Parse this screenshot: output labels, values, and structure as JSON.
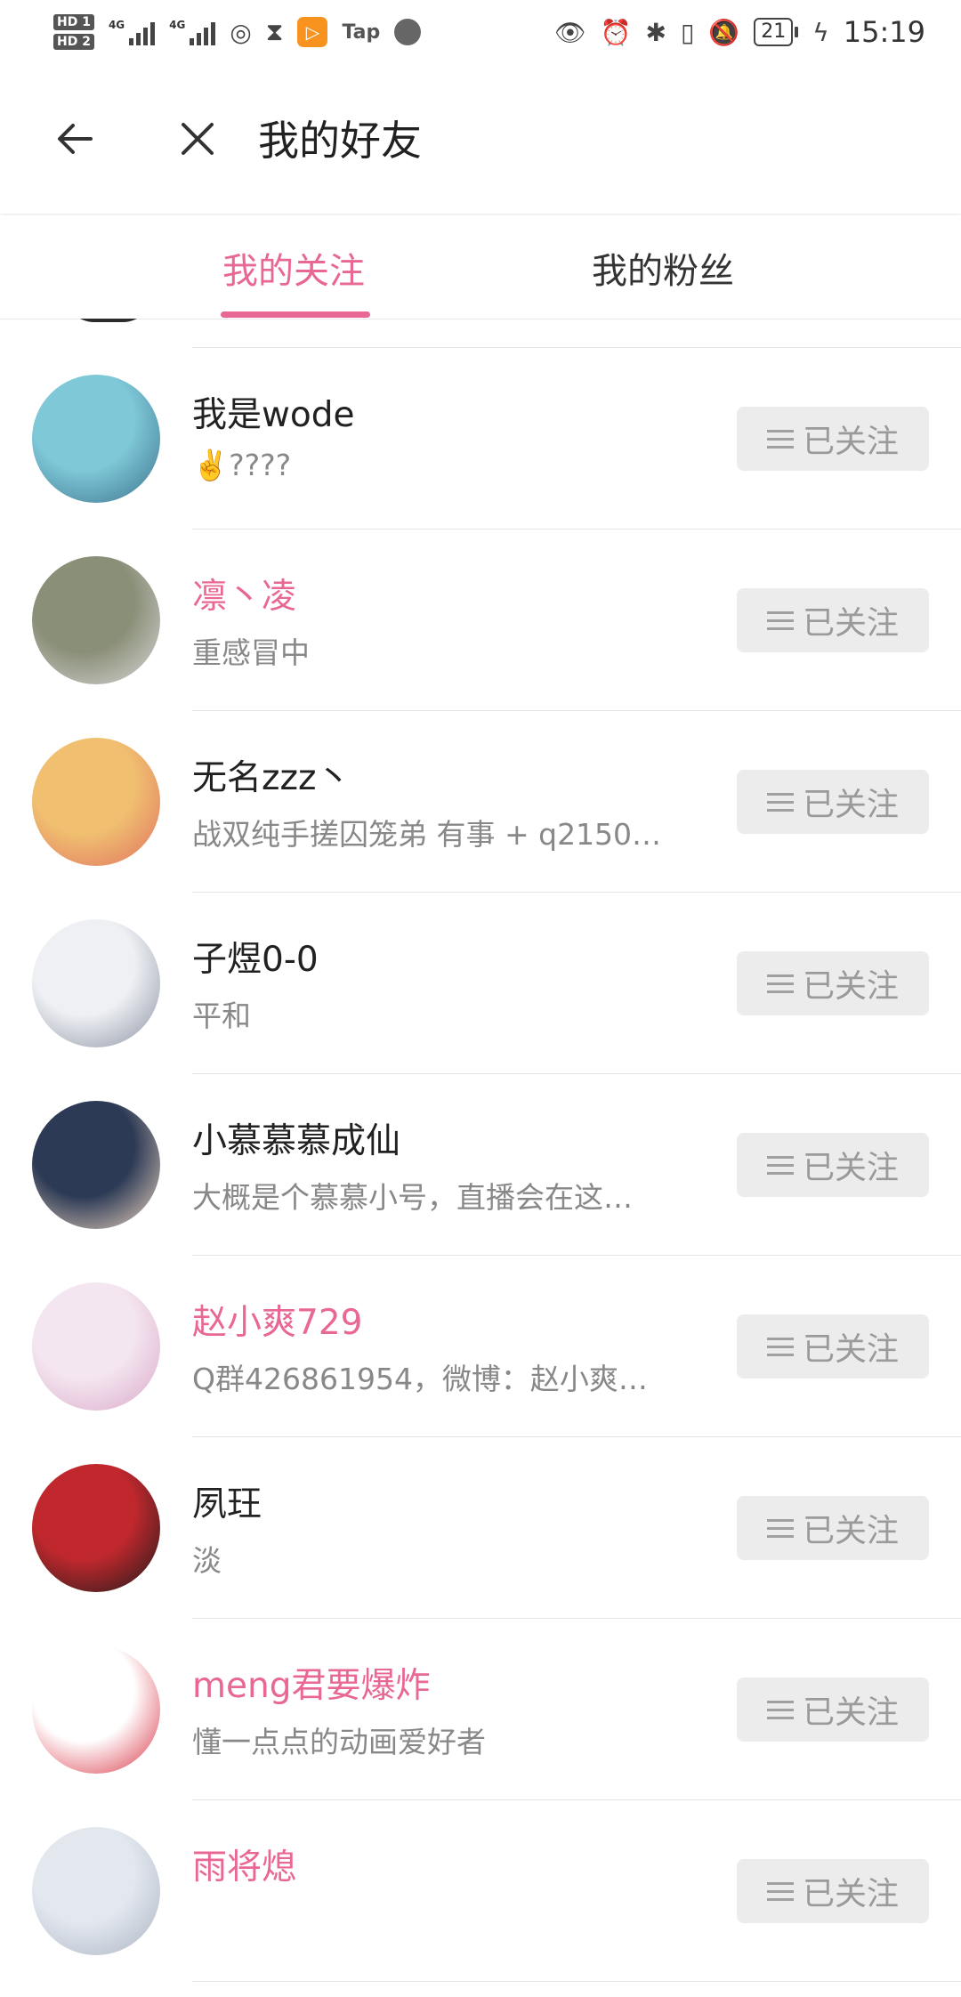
{
  "status_bar": {
    "hd1": "HD 1",
    "hd2": "HD 2",
    "net1": "4G",
    "net2": "4G",
    "tap": "Tap",
    "battery": "21",
    "time": "15:19",
    "icons": [
      "signal-icon",
      "wifi-icon",
      "hourglass-icon",
      "tap-app-icon",
      "globe-icon",
      "eye-icon",
      "alarm-icon",
      "bluetooth-icon",
      "vibrate-icon",
      "mute-icon",
      "battery-icon",
      "charging-icon"
    ]
  },
  "header": {
    "title": "我的好友"
  },
  "tabs": [
    {
      "label": "我的关注",
      "active": true
    },
    {
      "label": "我的粉丝",
      "active": false
    }
  ],
  "colors": {
    "accent": "#e86795",
    "button_bg": "#ececec",
    "button_text": "#9a9a9a"
  },
  "users": [
    {
      "name": "我是wode",
      "signature": "✌️????",
      "pink": false,
      "button": "已关注",
      "avatar_colors": [
        "#7ec8d8",
        "#3b6f8a"
      ]
    },
    {
      "name": "凛丶凌",
      "signature": "重感冒中",
      "pink": true,
      "button": "已关注",
      "avatar_colors": [
        "#8a8f78",
        "#d9d9d9"
      ]
    },
    {
      "name": "无名zzz丶",
      "signature": "战双纯手搓囚笼弟 有事 + q2150…",
      "pink": false,
      "button": "已关注",
      "avatar_colors": [
        "#f0c070",
        "#e07060"
      ]
    },
    {
      "name": "子煜0-0",
      "signature": "平和",
      "pink": false,
      "button": "已关注",
      "avatar_colors": [
        "#eef0f4",
        "#8a90a0"
      ]
    },
    {
      "name": "小慕慕慕成仙",
      "signature": "大概是个慕慕小号，直播会在这…",
      "pink": false,
      "button": "已关注",
      "avatar_colors": [
        "#2c3a55",
        "#f2d9c4"
      ]
    },
    {
      "name": "赵小爽729",
      "signature": "Q群426861954，微博：赵小爽…",
      "pink": true,
      "button": "已关注",
      "avatar_colors": [
        "#f4e6f0",
        "#d9a7c8"
      ]
    },
    {
      "name": "夙玨",
      "signature": "淡",
      "pink": false,
      "button": "已关注",
      "avatar_colors": [
        "#c0282d",
        "#1a1a1a"
      ]
    },
    {
      "name": "meng君要爆炸",
      "signature": "懂一点点的动画爱好者",
      "pink": true,
      "button": "已关注",
      "avatar_colors": [
        "#ffffff",
        "#d83040"
      ]
    },
    {
      "name": "雨将熄",
      "signature": "",
      "pink": true,
      "button": "已关注",
      "avatar_colors": [
        "#e3e8ef",
        "#a9b3c2"
      ]
    }
  ]
}
